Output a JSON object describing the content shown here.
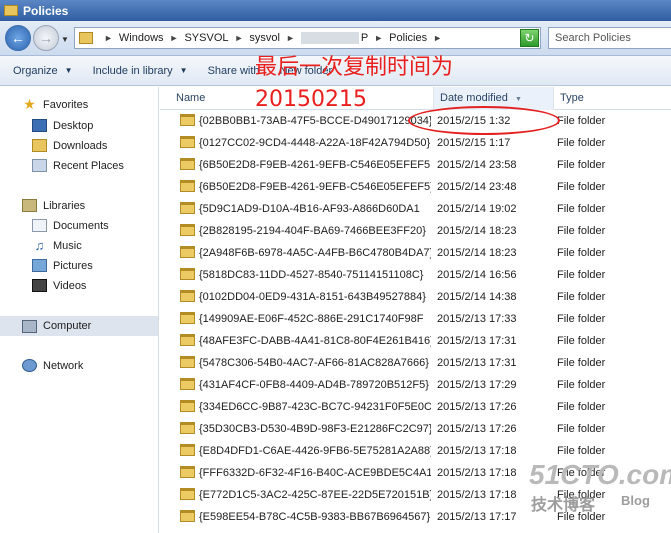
{
  "window": {
    "title": "Policies"
  },
  "address": {
    "crumbs": [
      "Windows",
      "SYSVOL",
      "sysvol",
      "P",
      "Policies"
    ],
    "search_placeholder": "Search Policies"
  },
  "toolbar": {
    "organize": "Organize",
    "include_in_library": "Include in library",
    "share_with": "Share with",
    "new_folder": "New folder"
  },
  "annotation": {
    "line1": "最后一次复制时间为",
    "line2": "20150215",
    "color": "#e9201d"
  },
  "nav": {
    "favorites": "Favorites",
    "desktop": "Desktop",
    "downloads": "Downloads",
    "recent_places": "Recent Places",
    "libraries": "Libraries",
    "documents": "Documents",
    "music": "Music",
    "pictures": "Pictures",
    "videos": "Videos",
    "computer": "Computer",
    "network": "Network"
  },
  "columns": {
    "name": "Name",
    "date_modified": "Date modified",
    "type": "Type"
  },
  "rows": [
    {
      "name": "{02BB0BB1-73AB-47F5-BCCE-D49017129034}",
      "date": "2015/2/15 1:32",
      "type": "File folder"
    },
    {
      "name": "{0127CC02-9CD4-4448-A22A-18F42A794D50}",
      "date": "2015/2/15 1:17",
      "type": "File folder"
    },
    {
      "name": "{6B50E2D8-F9EB-4261-9EFB-C546E05EFEF5",
      "date": "2015/2/14 23:58",
      "type": "File folder"
    },
    {
      "name": "{6B50E2D8-F9EB-4261-9EFB-C546E05EFEF5}",
      "date": "2015/2/14 23:48",
      "type": "File folder"
    },
    {
      "name": "{5D9C1AD9-D10A-4B16-AF93-A866D60DA1",
      "date": "2015/2/14 19:02",
      "type": "File folder"
    },
    {
      "name": "{2B828195-2194-404F-BA69-7466BEE3FF20}",
      "date": "2015/2/14 18:23",
      "type": "File folder"
    },
    {
      "name": "{2A948F6B-6978-4A5C-A4FB-B6C4780B4DA7}",
      "date": "2015/2/14 18:23",
      "type": "File folder"
    },
    {
      "name": "{5818DC83-11DD-4527-8540-75114151108C}",
      "date": "2015/2/14 16:56",
      "type": "File folder"
    },
    {
      "name": "{0102DD04-0ED9-431A-8151-643B49527884}",
      "date": "2015/2/14 14:38",
      "type": "File folder"
    },
    {
      "name": "{149909AE-E06F-452C-886E-291C1740F98F",
      "date": "2015/2/13 17:33",
      "type": "File folder"
    },
    {
      "name": "{48AFE3FC-DABB-4A41-81C8-80F4E261B416}",
      "date": "2015/2/13 17:31",
      "type": "File folder"
    },
    {
      "name": "{5478C306-54B0-4AC7-AF66-81AC828A7666}",
      "date": "2015/2/13 17:31",
      "type": "File folder"
    },
    {
      "name": "{431AF4CF-0FB8-4409-AD4B-789720B512F5}",
      "date": "2015/2/13 17:29",
      "type": "File folder"
    },
    {
      "name": "{334ED6CC-9B87-423C-BC7C-94231F0F5E0C}",
      "date": "2015/2/13 17:26",
      "type": "File folder"
    },
    {
      "name": "{35D30CB3-D530-4B9D-98F3-E21286FC2C97}",
      "date": "2015/2/13 17:26",
      "type": "File folder"
    },
    {
      "name": "{E8D4DFD1-C6AE-4426-9FB6-5E75281A2A88}",
      "date": "2015/2/13 17:18",
      "type": "File folder"
    },
    {
      "name": "{FFF6332D-6F32-4F16-B40C-ACE9BDE5C4A1}",
      "date": "2015/2/13 17:18",
      "type": "File folder"
    },
    {
      "name": "{E772D1C5-3AC2-425C-87EE-22D5E720151B}",
      "date": "2015/2/13 17:18",
      "type": "File folder"
    },
    {
      "name": "{E598EE54-B78C-4C5B-9383-BB67B6964567}",
      "date": "2015/2/13 17:17",
      "type": "File folder"
    }
  ],
  "watermark": {
    "big": "51CTO.com",
    "small": "技术博客",
    "blog": "Blog"
  }
}
